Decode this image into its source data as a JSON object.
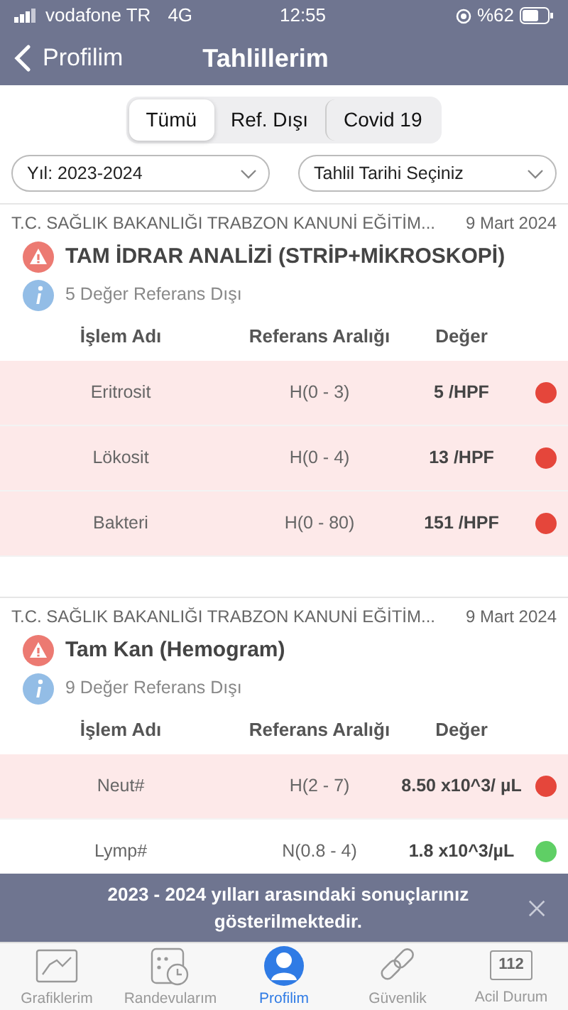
{
  "status_bar": {
    "carrier": "vodafone TR",
    "network": "4G",
    "time": "12:55",
    "battery": "%62"
  },
  "nav": {
    "back": "Profilim",
    "title": "Tahlillerim"
  },
  "segments": [
    {
      "label": "Tümü",
      "selected": true
    },
    {
      "label": "Ref. Dışı",
      "selected": false
    },
    {
      "label": "Covid 19",
      "selected": false
    }
  ],
  "filters": [
    {
      "value": "Yıl: 2023-2024"
    },
    {
      "value": "Tahlil Tarihi Seçiniz"
    }
  ],
  "tests": [
    {
      "hospital": "T.C. SAĞLIK BAKANLIĞI TRABZON KANUNİ EĞİTİM...",
      "date": "9 Mart 2024",
      "title": "TAM İDRAR ANALİZİ (STRİP+MİKROSKOPİ)",
      "info": "5 Değer Referans Dışı",
      "columns": [
        "İşlem Adı",
        "Referans Aralığı",
        "Değer"
      ],
      "rows": [
        {
          "name": "Eritrosit",
          "range": "H(0 - 3)",
          "value": "5 /HPF",
          "out_of_range": true,
          "color": "#e5463b"
        },
        {
          "name": "Lökosit",
          "range": "H(0 - 4)",
          "value": "13 /HPF",
          "out_of_range": true,
          "color": "#e5463b"
        },
        {
          "name": "Bakteri",
          "range": "H(0 - 80)",
          "value": "151 /HPF",
          "out_of_range": true,
          "color": "#e5463b"
        }
      ]
    },
    {
      "hospital": "T.C. SAĞLIK BAKANLIĞI TRABZON KANUNİ EĞİTİM...",
      "date": "9 Mart 2024",
      "title": "Tam Kan (Hemogram)",
      "info": "9 Değer Referans Dışı",
      "columns": [
        "İşlem Adı",
        "Referans Aralığı",
        "Değer"
      ],
      "rows": [
        {
          "name": "Neut#",
          "range": "H(2 - 7)",
          "value": "8.50 x10^3/ µL",
          "out_of_range": true,
          "color": "#e5463b"
        },
        {
          "name": "Lymp#",
          "range": "N(0.8 - 4)",
          "value": "1.8 x10^3/µL",
          "out_of_range": false,
          "color": "#5fcf65"
        }
      ]
    }
  ],
  "toast": {
    "message": "2023 - 2024 yılları arasındaki sonuçlarınız gösterilmektedir."
  },
  "tab_bar": [
    {
      "label": "Grafiklerim",
      "kind": "chart",
      "selected": false
    },
    {
      "label": "Randevularım",
      "kind": "calendar",
      "selected": false
    },
    {
      "label": "Profilim",
      "kind": "profile",
      "selected": true
    },
    {
      "label": "Güvenlik",
      "kind": "link",
      "selected": false
    },
    {
      "label": "Acil Durum",
      "kind": "emergency",
      "icon_text": "112",
      "selected": false
    }
  ]
}
